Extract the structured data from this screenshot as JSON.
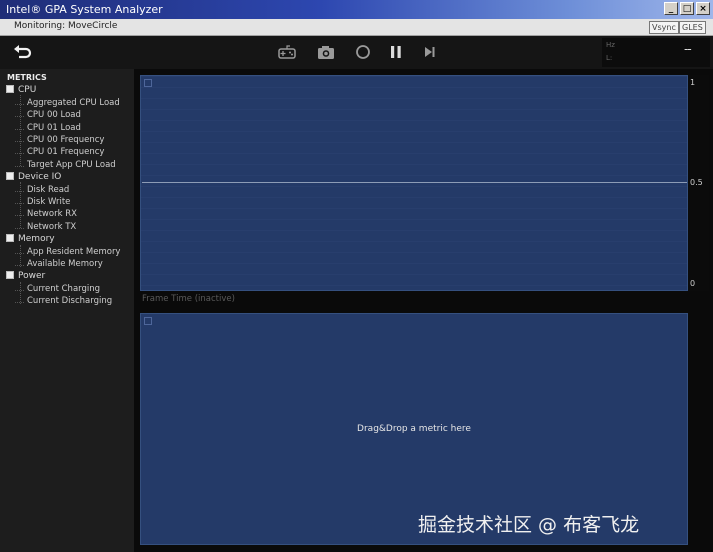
{
  "window": {
    "title": "Intel® GPA System Analyzer",
    "minimize_glyph": "_",
    "maximize_glyph": "□",
    "close_glyph": "×"
  },
  "monitor": {
    "text": "Monitoring: MoveCircle",
    "vsync": "Vsync",
    "gles": "GLES"
  },
  "toolbar": {
    "icons": [
      "back-arrow-icon",
      "gamepad-icon",
      "camera-icon",
      "record-icon",
      "pause-icon",
      "step-forward-icon"
    ],
    "readout_labels": [
      "Hz",
      "L:"
    ],
    "readout_value": "--"
  },
  "sidebar": {
    "header": "METRICS",
    "categories": [
      {
        "label": "CPU",
        "items": [
          "Aggregated CPU Load",
          "CPU 00 Load",
          "CPU 01 Load",
          "CPU 00 Frequency",
          "CPU 01 Frequency",
          "Target App CPU Load"
        ]
      },
      {
        "label": "Device IO",
        "items": [
          "Disk Read",
          "Disk Write",
          "Network RX",
          "Network TX"
        ]
      },
      {
        "label": "Memory",
        "items": [
          "App Resident Memory",
          "Available Memory"
        ]
      },
      {
        "label": "Power",
        "items": [
          "Current Charging",
          "Current Discharging"
        ]
      }
    ]
  },
  "chart1": {
    "y_ticks": [
      "1",
      "0.5",
      "0"
    ],
    "label": "Frame Time (inactive)"
  },
  "chart2": {
    "drop_hint": "Drag&Drop a metric here"
  },
  "watermark": "掘金技术社区 @ 布客飞龙"
}
